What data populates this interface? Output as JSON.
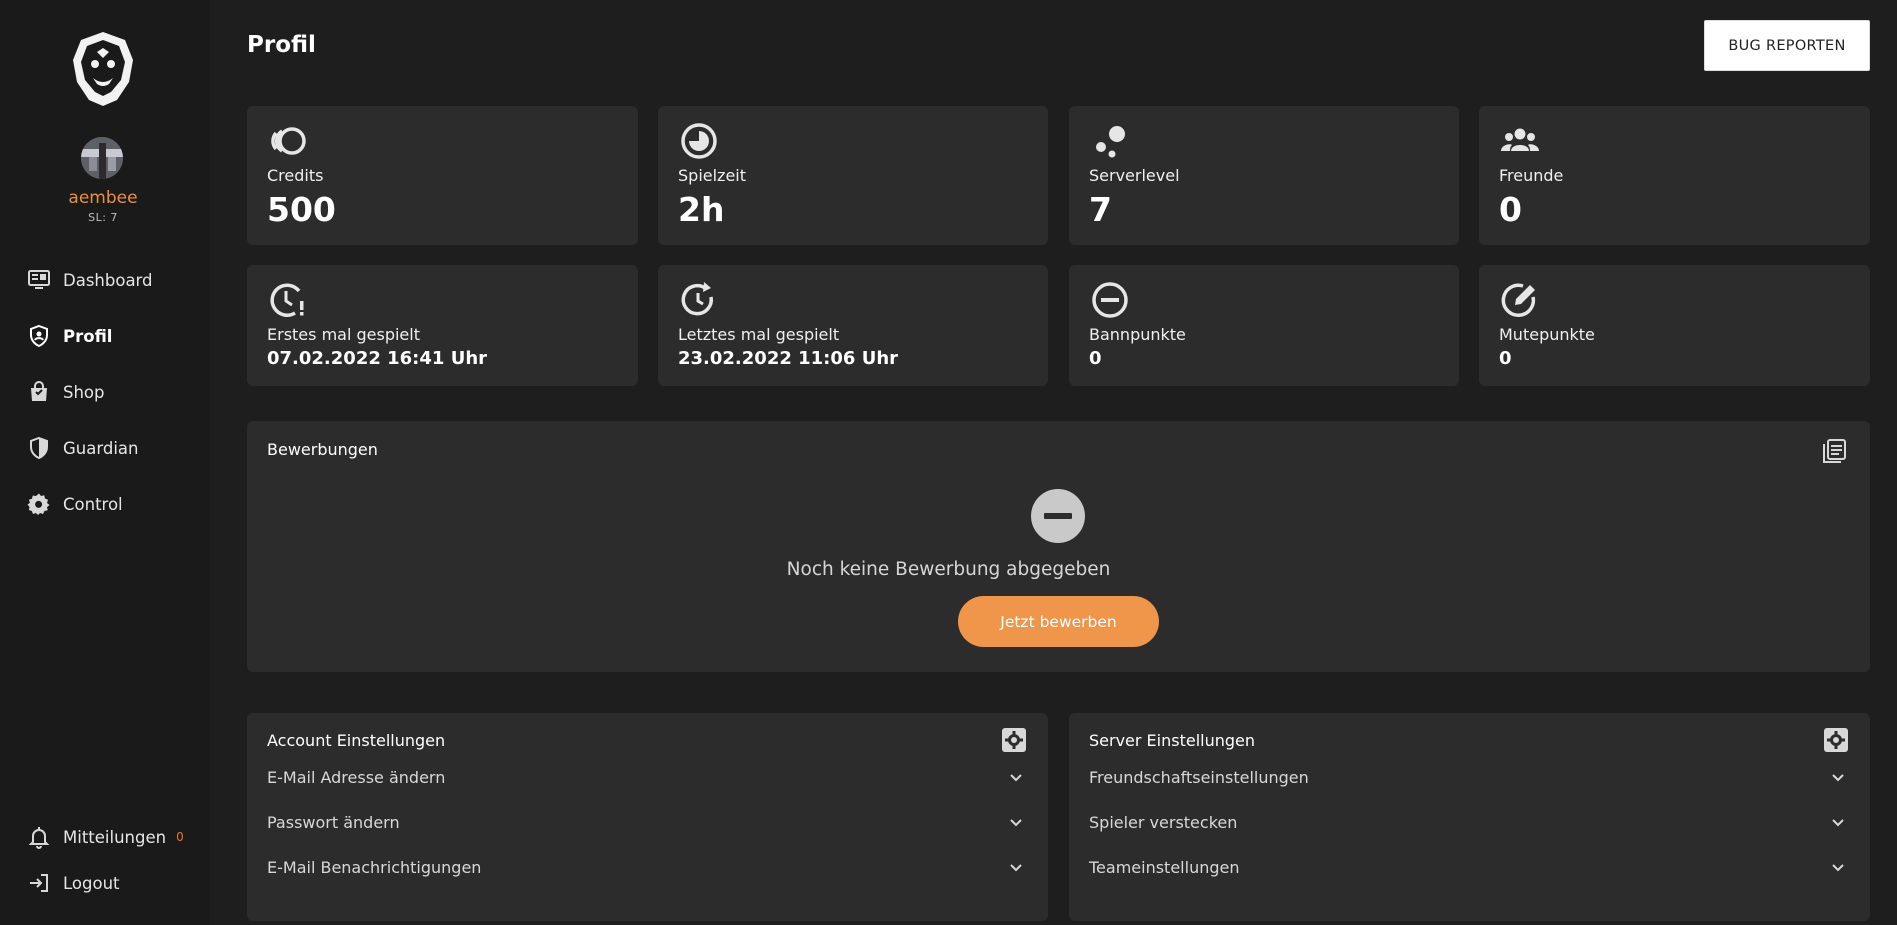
{
  "sidebar": {
    "username": "aembee",
    "server_level": "SL: 7",
    "nav": [
      {
        "label": "Dashboard",
        "icon": "dashboard-icon"
      },
      {
        "label": "Profil",
        "icon": "profile-shield-icon"
      },
      {
        "label": "Shop",
        "icon": "shopping-bag-icon"
      },
      {
        "label": "Guardian",
        "icon": "shield-icon"
      },
      {
        "label": "Control",
        "icon": "gear-icon"
      }
    ],
    "notifications": {
      "label": "Mitteilungen",
      "count": "0"
    },
    "logout": {
      "label": "Logout"
    }
  },
  "header": {
    "title": "Profil",
    "bug_button": "BUG REPORTEN"
  },
  "stats": [
    {
      "label": "Credits",
      "value": "500",
      "icon": "credits-icon"
    },
    {
      "label": "Spielzeit",
      "value": "2h",
      "icon": "pie-clock-icon"
    },
    {
      "label": "Serverlevel",
      "value": "7",
      "icon": "bubbles-icon"
    },
    {
      "label": "Freunde",
      "value": "0",
      "icon": "group-icon"
    },
    {
      "label": "Erstes mal gespielt",
      "value": "07.02.2022 16:41 Uhr",
      "icon": "clock-alert-icon"
    },
    {
      "label": "Letztes mal gespielt",
      "value": "23.02.2022 11:06 Uhr",
      "icon": "clock-refresh-icon"
    },
    {
      "label": "Bannpunkte",
      "value": "0",
      "icon": "minus-circle-icon"
    },
    {
      "label": "Mutepunkte",
      "value": "0",
      "icon": "edit-circle-icon"
    }
  ],
  "applications": {
    "title": "Bewerbungen",
    "empty_text": "Noch keine Bewerbung abgegeben",
    "apply_button": "Jetzt bewerben"
  },
  "account_settings": {
    "title": "Account Einstellungen",
    "items": [
      "E-Mail Adresse ändern",
      "Passwort ändern",
      "E-Mail Benachrichtigungen"
    ]
  },
  "server_settings": {
    "title": "Server Einstellungen",
    "items": [
      "Freundschaftseinstellungen",
      "Spieler verstecken",
      "Teameinstellungen"
    ]
  },
  "colors": {
    "accent": "#f0964b",
    "username": "#ef8f3d",
    "card_bg": "#2c2c2c",
    "page_bg": "#1e1e1e"
  }
}
